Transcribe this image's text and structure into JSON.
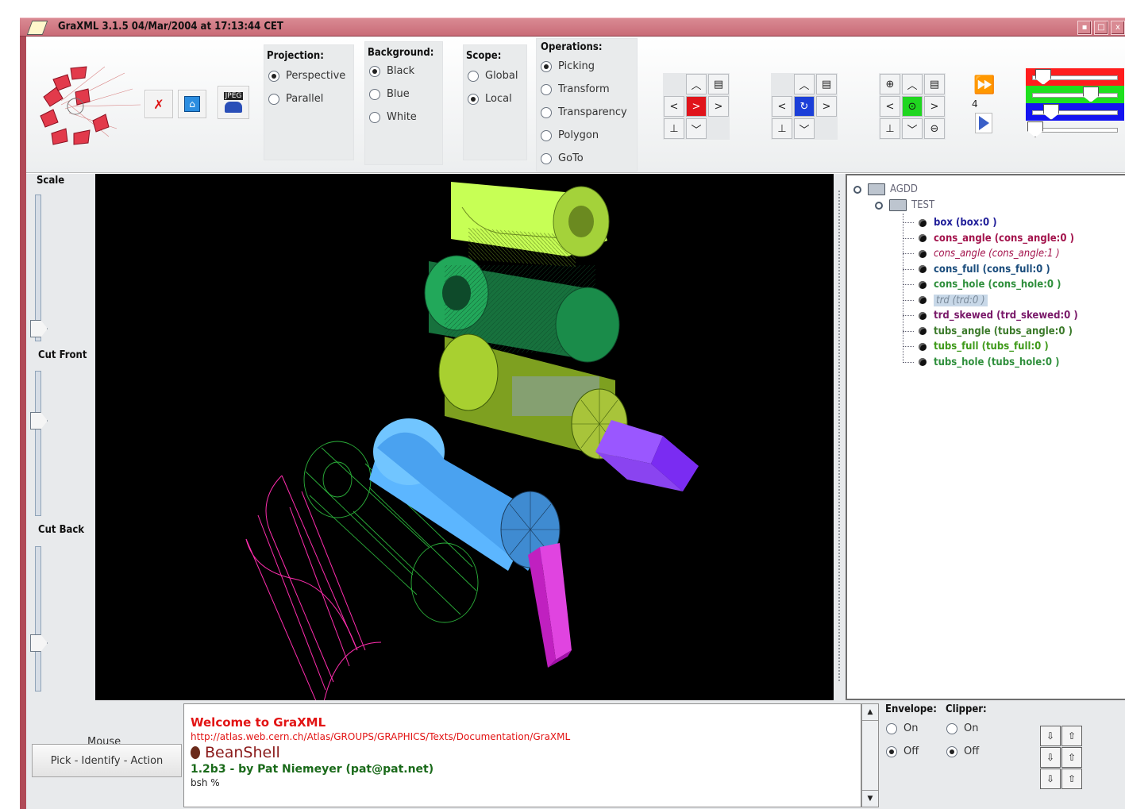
{
  "window": {
    "title": "GraXML 3.1.5 04/Mar/2004 at 17:13:44 CET"
  },
  "toolbar": {
    "projection": {
      "label": "Projection:",
      "options": [
        "Perspective",
        "Parallel"
      ],
      "selected": "Perspective"
    },
    "background": {
      "label": "Background:",
      "options": [
        "Black",
        "Blue",
        "White"
      ],
      "selected": "Black"
    },
    "scope": {
      "label": "Scope:",
      "options": [
        "Global",
        "Local"
      ],
      "selected": "Local"
    },
    "operations": {
      "label": "Operations:",
      "options": [
        "Picking",
        "Transform",
        "Transparency",
        "Polygon",
        "GoTo"
      ],
      "selected": "Picking"
    },
    "tool_buttons": {
      "jpeg_label": "JPEG"
    },
    "step_count": "4"
  },
  "sliders": {
    "scale": "Scale",
    "cut_front": "Cut Front",
    "cut_back": "Cut Back"
  },
  "tree": {
    "root": "AGDD",
    "child": "TEST",
    "items": [
      {
        "label": "box (box:0 )",
        "color": "#22209a"
      },
      {
        "label": "cons_angle (cons_angle:0 )",
        "color": "#a3134c"
      },
      {
        "label": "cons_angle (cons_angle:1 )",
        "color": "#a3134c"
      },
      {
        "label": "cons_full (cons_full:0 )",
        "color": "#1a4c7c"
      },
      {
        "label": "cons_hole (cons_hole:0 )",
        "color": "#2f8f3c"
      },
      {
        "label": "trd (trd:0 )",
        "color": "#7a8a9a"
      },
      {
        "label": "trd_skewed (trd_skewed:0 )",
        "color": "#7a1a6a"
      },
      {
        "label": "tubs_angle (tubs_angle:0 )",
        "color": "#3b7a2a"
      },
      {
        "label": "tubs_full (tubs_full:0 )",
        "color": "#3f9a1a"
      },
      {
        "label": "tubs_hole (tubs_hole:0 )",
        "color": "#2f8f3c"
      }
    ]
  },
  "console": {
    "welcome": "Welcome to GraXML",
    "url": "http://atlas.web.cern.ch/Atlas/GROUPS/GRAPHICS/Texts/Documentation/GraXML",
    "beanshell": "BeanShell",
    "version": "1.2b3 - by Pat Niemeyer (pat@pat.net)",
    "prompt": "bsh %"
  },
  "mouse": {
    "label": "Mouse",
    "button": "Pick - Identify - Action"
  },
  "envelope": {
    "label": "Envelope:",
    "options": [
      "On",
      "Off"
    ],
    "selected": "Off"
  },
  "clipper": {
    "label": "Clipper:",
    "options": [
      "On",
      "Off"
    ],
    "selected": "Off"
  }
}
